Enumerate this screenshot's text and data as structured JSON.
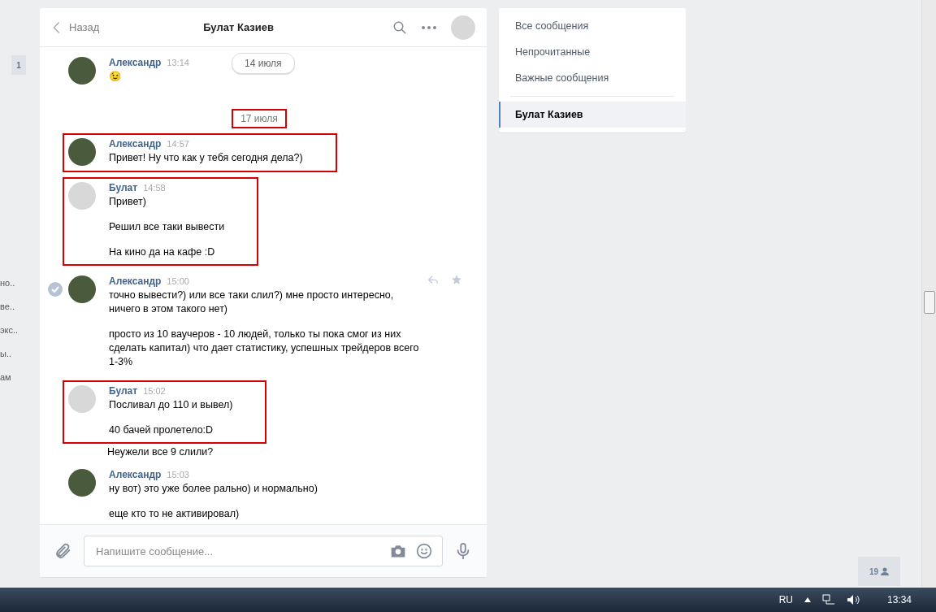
{
  "left_nav": {
    "badge": "1",
    "fragments": [
      "но..",
      "ве..",
      "экс..",
      "ы..",
      "ам"
    ]
  },
  "chat": {
    "back": "Назад",
    "title": "Булат Казиев",
    "floating_date": "14 июля",
    "items": [
      {
        "kind": "group",
        "author": "Александр",
        "time": "13:14",
        "color": "#4a5a3c",
        "selected": false,
        "messages": [
          {
            "text": "😉",
            "highlighted": false
          }
        ]
      },
      {
        "kind": "date",
        "text": "17 июля",
        "highlighted": true
      },
      {
        "kind": "group",
        "author": "Александр",
        "time": "14:57",
        "color": "#4a5a3c",
        "selected": false,
        "messages": [
          {
            "text": "Привет! Ну что как у тебя сегодня дела?)",
            "highlighted": true
          }
        ]
      },
      {
        "kind": "group",
        "author": "Булат",
        "time": "14:58",
        "color": "#d8d8d8",
        "selected": false,
        "messages": [
          {
            "text": "Привет)",
            "highlighted": true
          },
          {
            "text": "Решил все таки вывести",
            "highlighted": true
          },
          {
            "text": "На кино да на кафе :D",
            "highlighted": true
          }
        ]
      },
      {
        "kind": "group",
        "author": "Александр",
        "time": "15:00",
        "color": "#4a5a3c",
        "selected": true,
        "messages": [
          {
            "text": "точно вывести?) или все таки слил?) мне просто интересно, ничего в этом такого нет)",
            "highlighted": false
          },
          {
            "text": "просто из 10 ваучеров - 10 людей, только ты пока смог из них сделать капитал) что дает статистику, успешных трейдеров всего 1-3%",
            "highlighted": false
          }
        ]
      },
      {
        "kind": "group",
        "author": "Булат",
        "time": "15:02",
        "color": "#d8d8d8",
        "selected": false,
        "messages": [
          {
            "text": "Посливал до 110 и вывел)",
            "highlighted": true
          },
          {
            "text": "40 бачей пролетело:D",
            "highlighted": true
          },
          {
            "text": "Неужели все 9 слили?",
            "highlighted": false
          }
        ]
      },
      {
        "kind": "group",
        "author": "Александр",
        "time": "15:03",
        "color": "#4a5a3c",
        "selected": false,
        "messages": [
          {
            "text": "ну вот) это уже более рально) и нормально)",
            "highlighted": false
          },
          {
            "text": "еще кто то не активировал)",
            "highlighted": false
          }
        ]
      }
    ],
    "composer": {
      "placeholder": "Напишите сообщение..."
    }
  },
  "menu": [
    {
      "label": "Все сообщения",
      "selected": false
    },
    {
      "label": "Непрочитанные",
      "selected": false
    },
    {
      "label": "Важные сообщения",
      "selected": false
    },
    {
      "label": "Булат Казиев",
      "selected": true,
      "kind": "chat"
    }
  ],
  "online_count": "19",
  "taskbar": {
    "language": "RU",
    "time": "13:34"
  }
}
